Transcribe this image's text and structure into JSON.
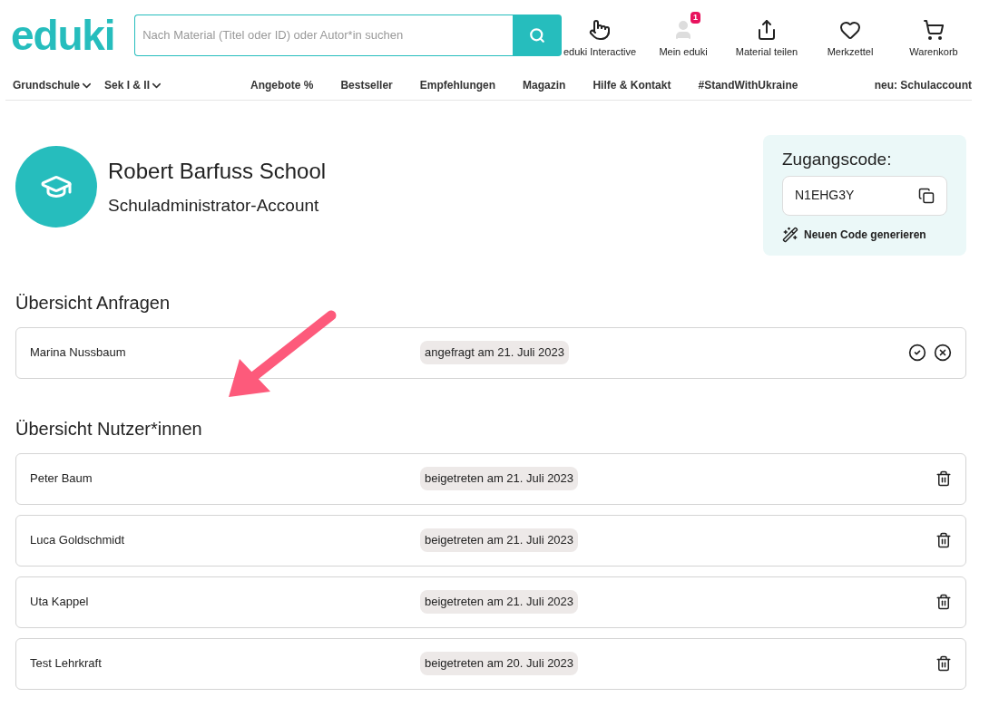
{
  "header": {
    "logo": "eduki",
    "search": {
      "placeholder": "Nach Material (Titel oder ID) oder Autor*in suchen"
    },
    "actions": [
      {
        "kind": "interactive",
        "label": "eduki Interactive"
      },
      {
        "kind": "account",
        "label": "Mein eduki",
        "badge": "1"
      },
      {
        "kind": "share",
        "label": "Material teilen"
      },
      {
        "kind": "wishlist",
        "label": "Merkzettel"
      },
      {
        "kind": "cart",
        "label": "Warenkorb"
      }
    ]
  },
  "nav": {
    "dropdowns": [
      "Grundschule",
      "Sek I & II"
    ],
    "links": [
      "Angebote %",
      "Bestseller",
      "Empfehlungen",
      "Magazin",
      "Hilfe & Kontakt",
      "#StandWithUkraine"
    ],
    "right": "neu: Schulaccount"
  },
  "school": {
    "name": "Robert Barfuss School",
    "role": "Schuladministrator-Account"
  },
  "access_code": {
    "title": "Zugangscode:",
    "code": "N1EHG3Y",
    "generate": "Neuen Code generieren"
  },
  "requests": {
    "title": "Übersicht Anfragen",
    "rows": [
      {
        "name": "Marina Nussbaum",
        "status": "angefragt am 21. Juli 2023"
      }
    ]
  },
  "users": {
    "title": "Übersicht Nutzer*innen",
    "rows": [
      {
        "name": "Peter Baum",
        "status": "beigetreten am 21. Juli 2023"
      },
      {
        "name": "Luca Goldschmidt",
        "status": "beigetreten am 21. Juli 2023"
      },
      {
        "name": "Uta Kappel",
        "status": "beigetreten am 21. Juli 2023"
      },
      {
        "name": "Test Lehrkraft",
        "status": "beigetreten am 20. Juli 2023"
      }
    ]
  }
}
